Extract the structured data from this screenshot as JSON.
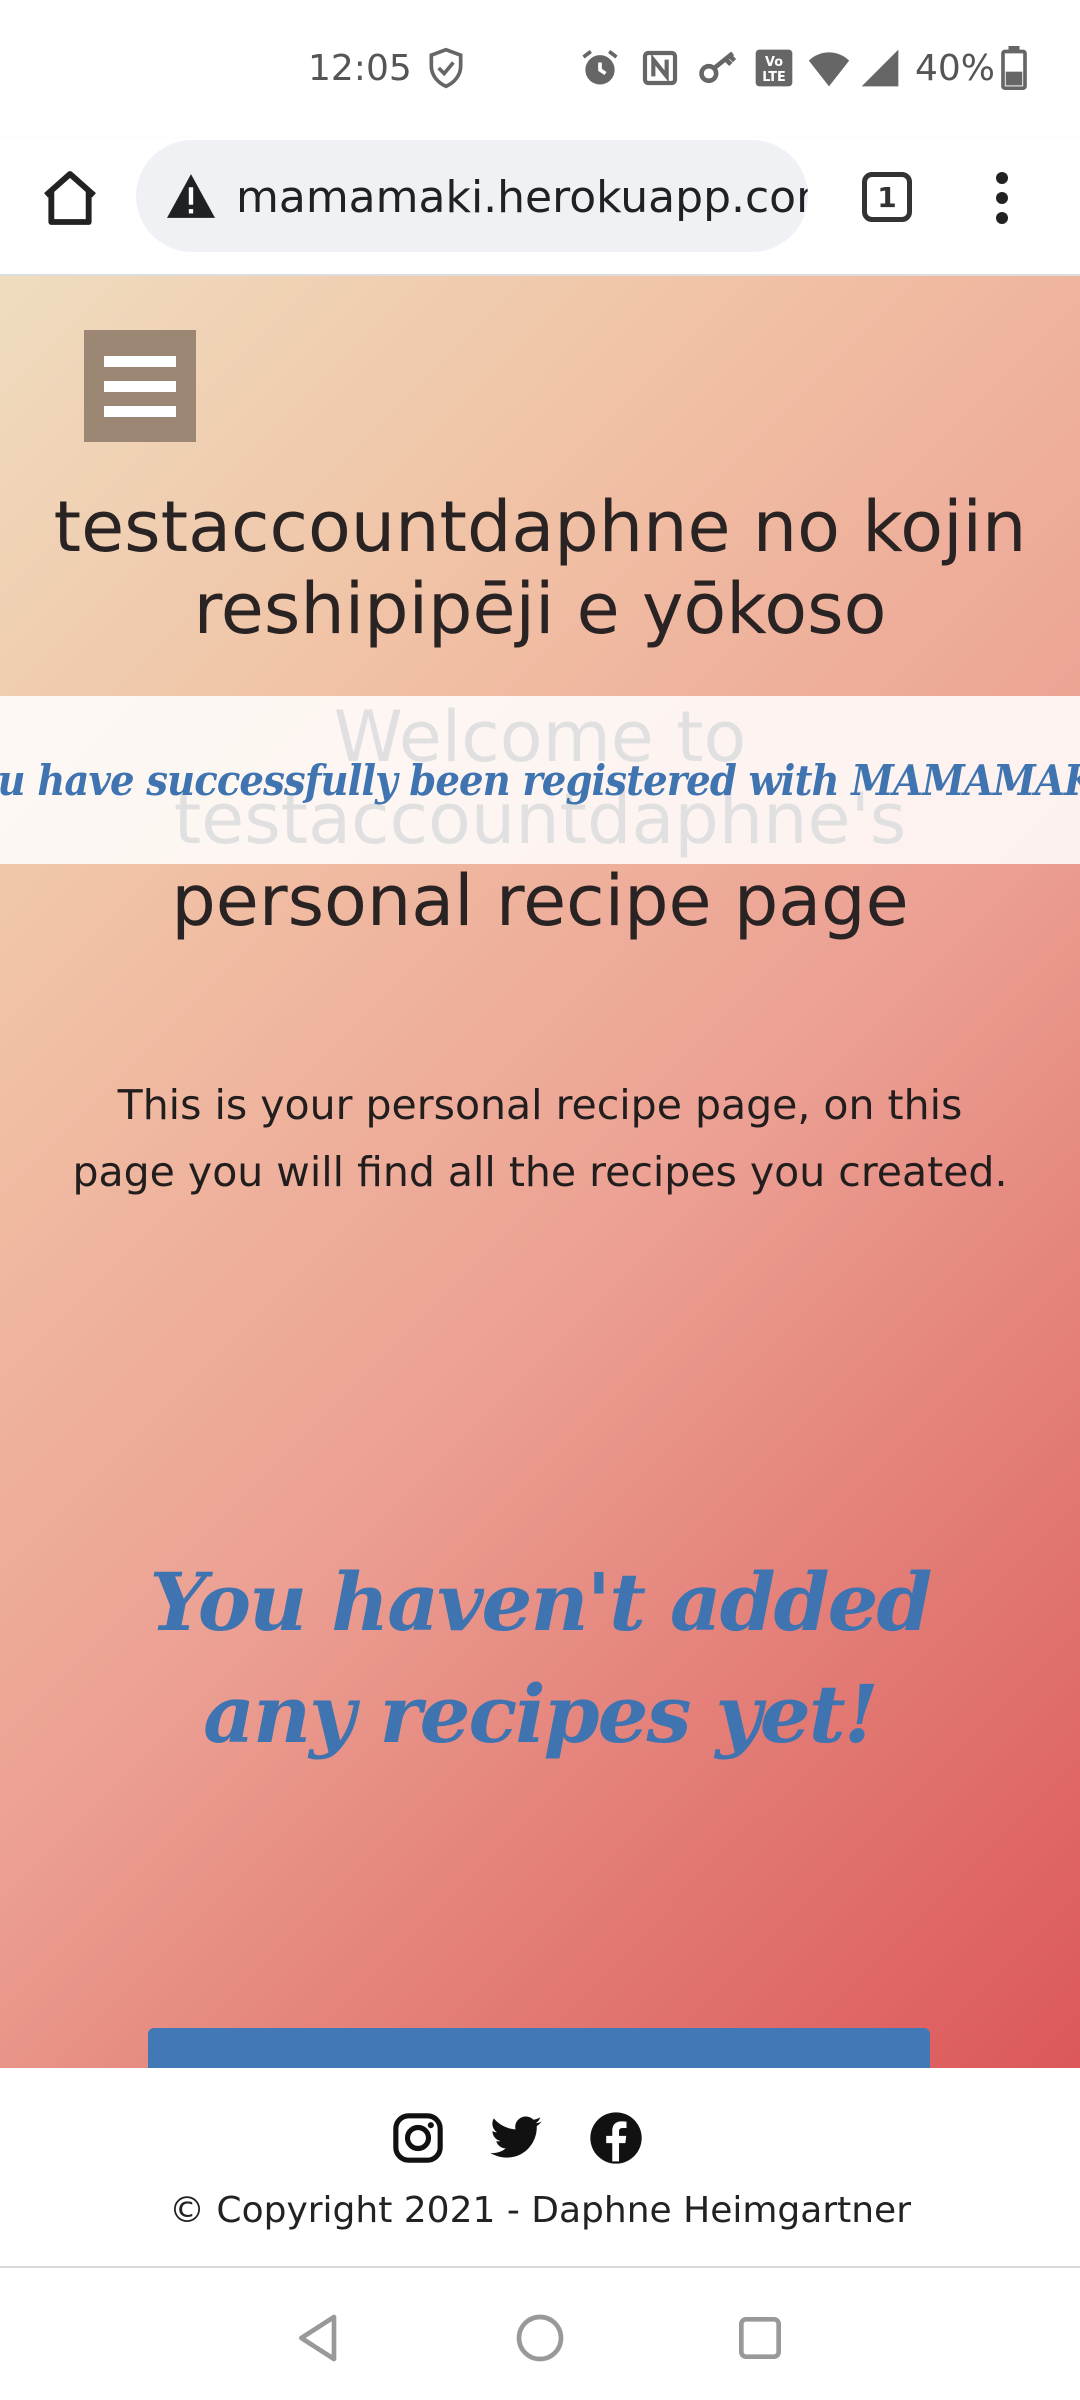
{
  "status_bar": {
    "time": "12:05",
    "battery": "40%",
    "icons": [
      "shield-check-icon",
      "alarm-icon",
      "nfc-icon",
      "key-icon",
      "volte-icon",
      "wifi-icon",
      "signal-icon",
      "battery-icon"
    ]
  },
  "browser": {
    "url": "mamamaki.herokuapp.com/",
    "tab_count": "1"
  },
  "page": {
    "heading_jp": "testaccountdaphne no kojin reshipipēji e yōkoso",
    "heading_en": "Welcome to testaccountdaphne's personal recipe page",
    "flash_message": "You have successfully been registered with MAMAMAKI!",
    "intro": "This is your personal recipe page, on this page you will find all the recipes you created.",
    "empty_message": "You haven't added any recipes yet!"
  },
  "footer": {
    "social": [
      "instagram-icon",
      "twitter-icon",
      "facebook-icon"
    ],
    "copyright": "© Copyright 2021 - Daphne Heimgartner"
  },
  "colors": {
    "accent_blue": "#3f74b1",
    "menu_bg": "#9b8774",
    "gradient_start": "#efdcbf",
    "gradient_end": "#dc585a"
  }
}
